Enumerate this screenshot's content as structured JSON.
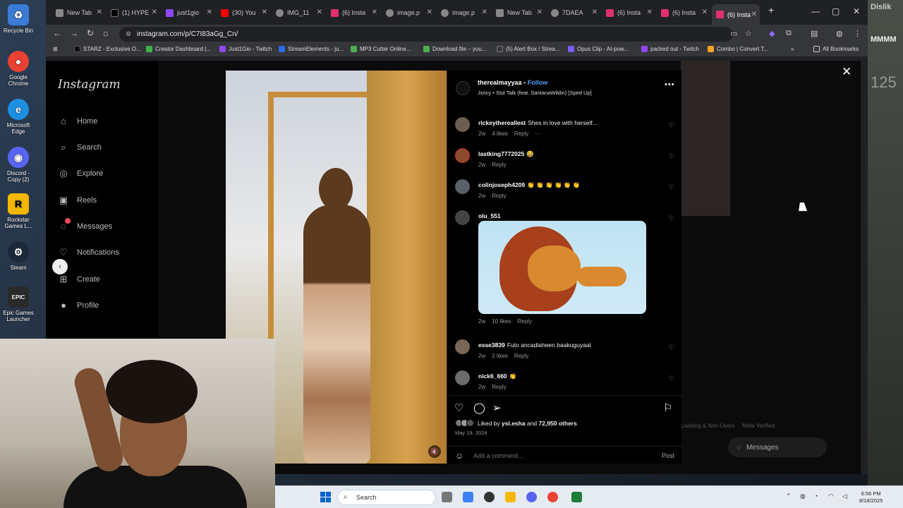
{
  "desktop": {
    "icons": [
      {
        "label": "Recycle Bin",
        "icon": "recycle-bin-icon",
        "color": "#3a7bd5"
      },
      {
        "label": "Google Chrome",
        "icon": "chrome-icon",
        "color": "#e94235"
      },
      {
        "label": "Microsoft Edge",
        "icon": "edge-icon",
        "color": "#1d8fe1"
      },
      {
        "label": "Discord - Copy (2)",
        "icon": "discord-icon",
        "color": "#5865f2"
      },
      {
        "label": "Rockstar Games L...",
        "icon": "rockstar-icon",
        "color": "#f5b800"
      },
      {
        "label": "Steam",
        "icon": "steam-icon",
        "color": "#1b2838"
      },
      {
        "label": "Epic Games Launcher",
        "icon": "epic-games-icon",
        "color": "#2a2a2a"
      }
    ]
  },
  "browser": {
    "tabs": [
      {
        "label": "New Tab",
        "icon": "chrome-icon",
        "color": "#888888"
      },
      {
        "label": "(1) HYPE",
        "icon": "x-icon",
        "color": "#000000"
      },
      {
        "label": "just1gio",
        "icon": "twitch-icon",
        "color": "#9146ff"
      },
      {
        "label": "(30) You",
        "icon": "youtube-icon",
        "color": "#ff0000"
      },
      {
        "label": "IMG_11",
        "icon": "globe-icon",
        "color": "#888888"
      },
      {
        "label": "(6) Insta",
        "icon": "instagram-icon",
        "color": "#e1306c"
      },
      {
        "label": "image.p",
        "icon": "globe-icon",
        "color": "#888888"
      },
      {
        "label": "image.p",
        "icon": "globe-icon",
        "color": "#888888"
      },
      {
        "label": "New Tab",
        "icon": "chrome-icon",
        "color": "#888888"
      },
      {
        "label": "7DAEA",
        "icon": "globe-icon",
        "color": "#888888"
      },
      {
        "label": "(6) Insta",
        "icon": "instagram-icon",
        "color": "#e1306c"
      },
      {
        "label": "(6) Insta",
        "icon": "instagram-icon",
        "color": "#e1306c"
      },
      {
        "label": "(6) Insta",
        "icon": "instagram-icon",
        "color": "#e1306c"
      }
    ],
    "url": "instagram.com/p/C7I83aGg_Cn/",
    "bookmarks": [
      {
        "label": "STARZ - Exclusive O...",
        "color": "#111111"
      },
      {
        "label": "Creator Dashboard |...",
        "color": "#3ab54a"
      },
      {
        "label": "Just1Gio - Twitch",
        "color": "#9146ff"
      },
      {
        "label": "StreamElements - ju...",
        "color": "#2b6ae6"
      },
      {
        "label": "MP3 Cutter Online...",
        "color": "#4caf50"
      },
      {
        "label": "Download file – you...",
        "color": "#4caf50"
      },
      {
        "label": "(5) Alert Box / Strea...",
        "color": "#3a3a3a"
      },
      {
        "label": "Opus Clip - AI-pow...",
        "color": "#7b5cff"
      },
      {
        "label": "packed out - Twitch",
        "color": "#9146ff"
      },
      {
        "label": "Combo | Convert T...",
        "color": "#f5a623"
      }
    ],
    "all_bookmarks": "All Bookmarks"
  },
  "instagram": {
    "logo": "Instagram",
    "nav": [
      {
        "label": "Home",
        "icon": "home-icon"
      },
      {
        "label": "Search",
        "icon": "search-icon"
      },
      {
        "label": "Explore",
        "icon": "compass-icon"
      },
      {
        "label": "Reels",
        "icon": "reels-icon"
      },
      {
        "label": "Messages",
        "icon": "messenger-icon"
      },
      {
        "label": "Notifications",
        "icon": "heart-icon"
      },
      {
        "label": "Create",
        "icon": "plus-square-icon"
      },
      {
        "label": "Profile",
        "icon": "profile-icon"
      }
    ],
    "post": {
      "username": "therealmayyaa",
      "follow": "Follow",
      "audio": "Jxncy • Slut Talk (feat. SantanaWildin) [Sped Up]",
      "likes_by": "ysl.esha",
      "likes_count": "72,950 others",
      "date": "May 19, 2024"
    },
    "comments": [
      {
        "user": "rickeythereallest",
        "text": "Shes in love with herself...",
        "age": "2w",
        "likes": "4 likes",
        "reply": "Reply",
        "more": "···"
      },
      {
        "user": "lastking7772025",
        "text": "😂",
        "age": "2w",
        "likes": "",
        "reply": "Reply"
      },
      {
        "user": "colinjoseph4209",
        "text": "👏 👏 👏 👏 👏 👏",
        "age": "2w",
        "likes": "",
        "reply": "Reply"
      },
      {
        "user": "olu_551",
        "text": "",
        "age": "2w",
        "likes": "10 likes",
        "reply": "Reply"
      },
      {
        "user": "esse3839",
        "text": "Futo ancadiaheen baakuguyaal",
        "age": "2w",
        "likes": "2 likes",
        "reply": "Reply"
      },
      {
        "user": "nick6_660",
        "text": "👏",
        "age": "2w",
        "likes": "",
        "reply": "Reply"
      }
    ],
    "add_comment_placeholder": "Add a comment...",
    "post_button": "Post",
    "footer_left": "Loading & Non-Users",
    "footer_right": "Meta Verified",
    "messages_pill": "Messages"
  },
  "taskbar": {
    "search_placeholder": "Search",
    "time": "6:56 PM",
    "date": "8/18/2025"
  },
  "stream_overlay": {
    "right_text_1": "Dislik",
    "right_text_2": "MMMM",
    "right_text_3": "125"
  }
}
